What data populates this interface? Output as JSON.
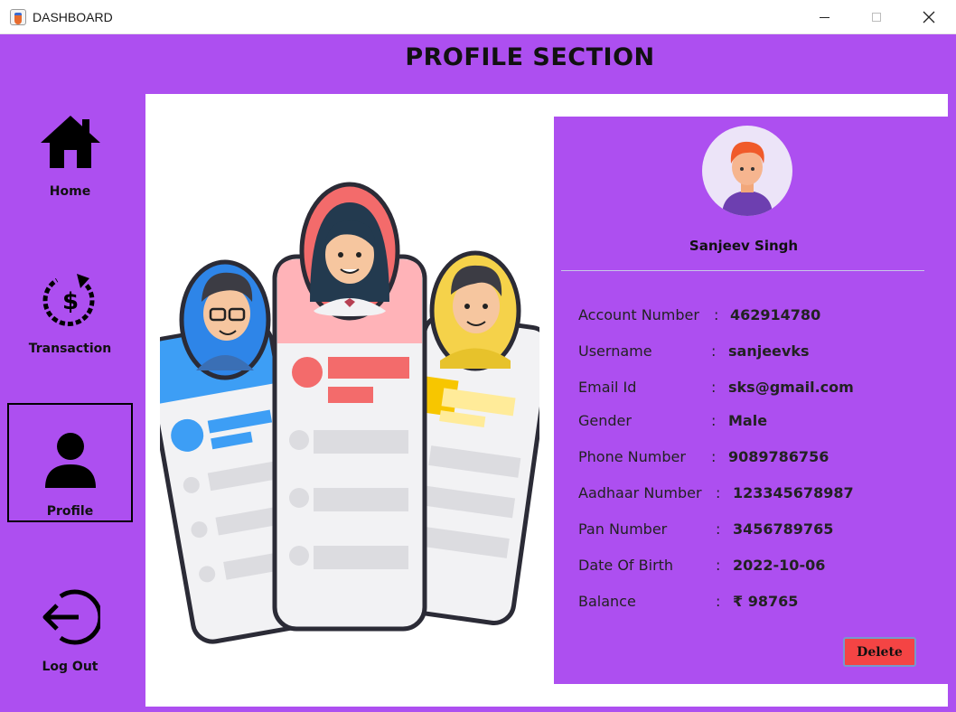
{
  "window": {
    "title": "DASHBOARD"
  },
  "header": {
    "title": "PROFILE SECTION"
  },
  "sidebar": {
    "items": [
      {
        "label": "Home",
        "icon": "home-icon"
      },
      {
        "label": "Transaction",
        "icon": "dollar-cycle-icon"
      },
      {
        "label": "Profile",
        "icon": "user-icon",
        "selected": true
      },
      {
        "label": "Log Out",
        "icon": "logout-icon"
      }
    ]
  },
  "profile": {
    "name": "Sanjeev Singh",
    "fields": [
      {
        "label": "Account Number",
        "value": "462914780"
      },
      {
        "label": "Username",
        "value": "sanjeevks"
      },
      {
        "label": "Email Id",
        "value": "sks@gmail.com"
      },
      {
        "label": "Gender",
        "value": "Male"
      },
      {
        "label": "Phone Number",
        "value": "9089786756"
      },
      {
        "label": "Aadhaar Number",
        "value": "123345678987"
      },
      {
        "label": "Pan Number",
        "value": "3456789765"
      },
      {
        "label": "Date Of Birth",
        "value": "2022-10-06"
      },
      {
        "label": "Balance",
        "value": "₹ 98765"
      }
    ],
    "colon": ":",
    "delete_label": "Delete"
  },
  "colors": {
    "accent": "#ad4ff0",
    "delete": "#f44444"
  }
}
